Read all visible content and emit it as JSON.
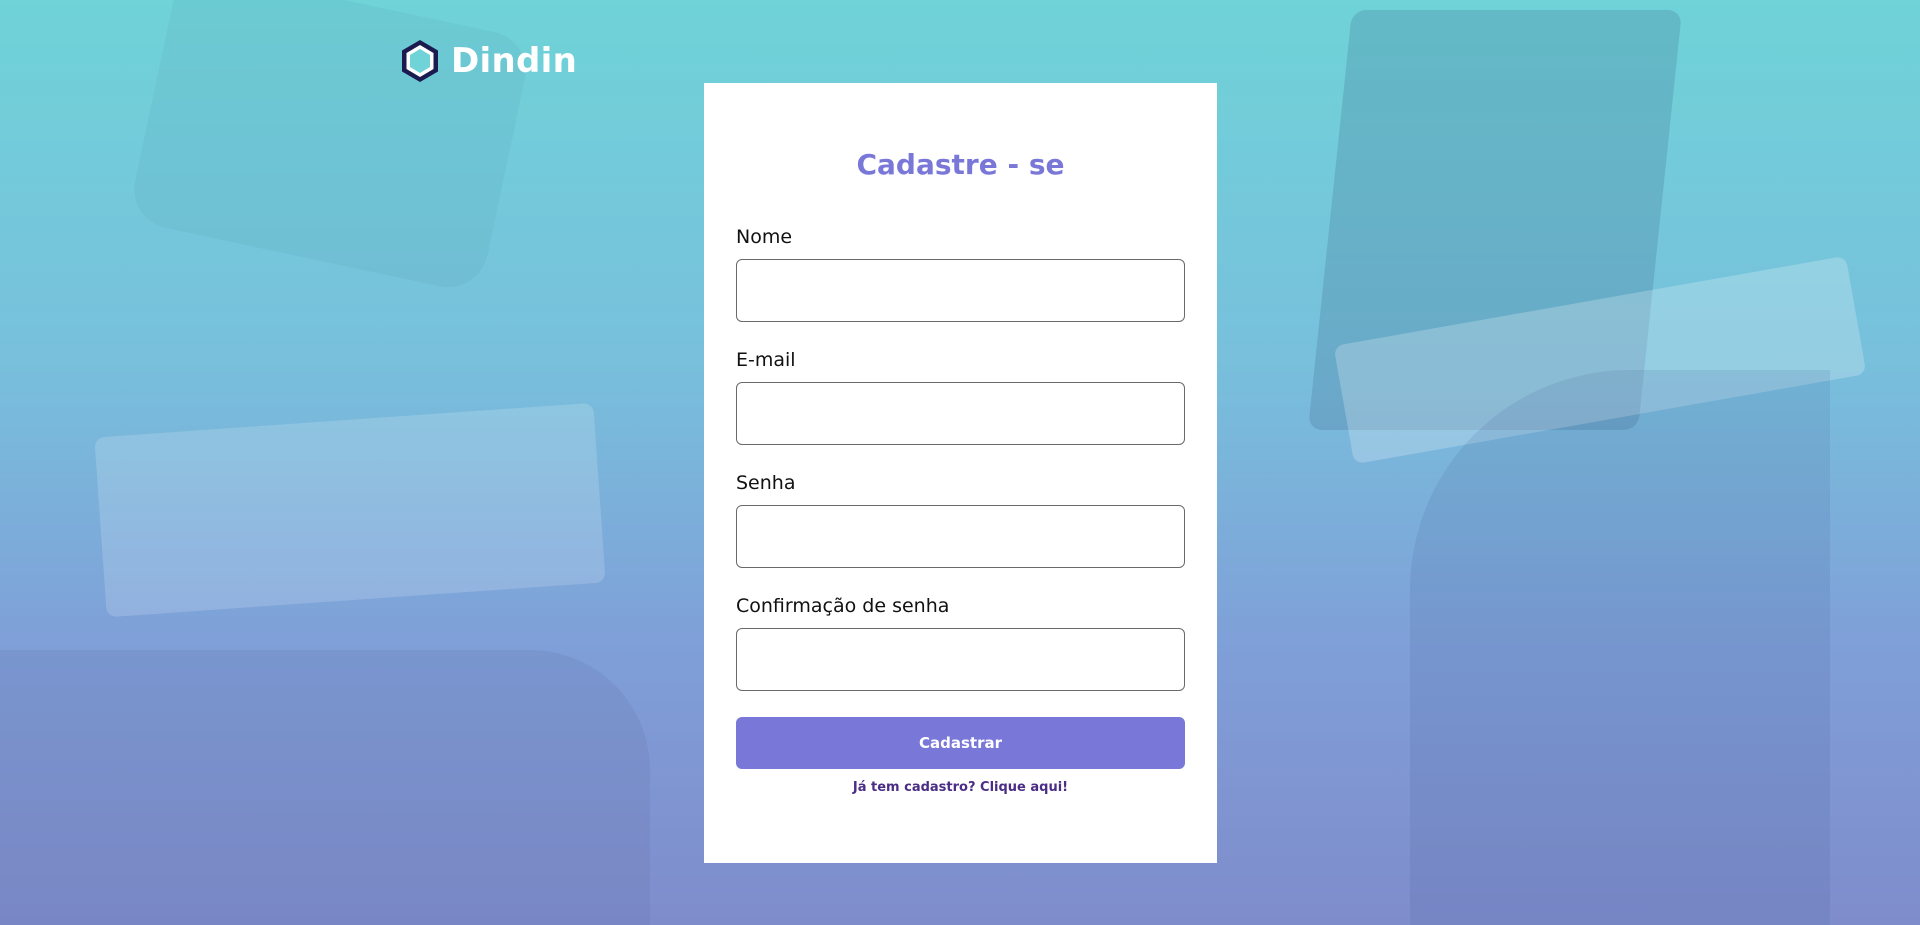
{
  "brand": {
    "name": "Dindin",
    "logo_icon": "hexagon-logo-icon",
    "colors": {
      "primary": "#7978d9",
      "logo_dark": "#1b1b4f",
      "logo_fill": "#6fd3d8"
    }
  },
  "form": {
    "title": "Cadastre - se",
    "fields": [
      {
        "label": "Nome",
        "value": "",
        "type": "text"
      },
      {
        "label": "E-mail",
        "value": "",
        "type": "email"
      },
      {
        "label": "Senha",
        "value": "",
        "type": "password"
      },
      {
        "label": "Confirmação de senha",
        "value": "",
        "type": "password"
      }
    ],
    "submit_label": "Cadastrar",
    "login_link": "Já tem cadastro? Clique aqui!"
  }
}
